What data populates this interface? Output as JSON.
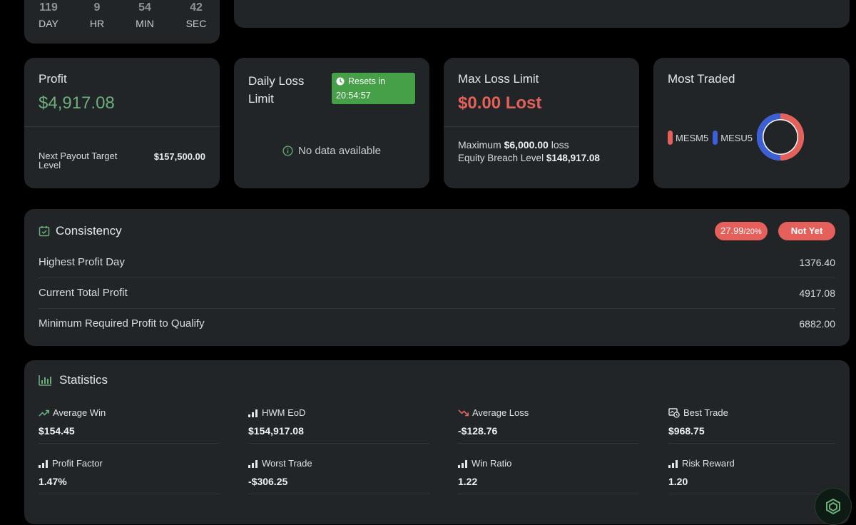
{
  "countdown": {
    "day": "119",
    "day_label": "DAY",
    "hr": "9",
    "hr_label": "HR",
    "min": "54",
    "min_label": "MIN",
    "sec": "42",
    "sec_label": "SEC"
  },
  "profit": {
    "title": "Profit",
    "value": "$4,917.08",
    "payout_label": "Next Payout Target Level",
    "payout_value": "$157,500.00"
  },
  "daily_loss": {
    "title": "Daily Loss Limit",
    "resets_label": "Resets in",
    "resets_time": "20:54:57",
    "empty_text": "No data available"
  },
  "max_loss": {
    "title": "Max Loss Limit",
    "value": "$0.00 Lost",
    "max_prefix": "Maximum",
    "max_amount": "$6,000.00",
    "max_suffix": "loss",
    "breach_label": "Equity Breach Level",
    "breach_value": "$148,917.08"
  },
  "most_traded": {
    "title": "Most Traded",
    "items": [
      {
        "label": "MESM5",
        "color": "#e5605a",
        "share": 0.5
      },
      {
        "label": "MESU5",
        "color": "#3b5fd6",
        "share": 0.5
      }
    ]
  },
  "consistency": {
    "title": "Consistency",
    "ratio": "27.99",
    "ratio_target": "/20%",
    "status": "Not Yet",
    "rows": [
      {
        "label": "Highest Profit Day",
        "value": "1376.40"
      },
      {
        "label": "Current Total Profit",
        "value": "4917.08"
      },
      {
        "label": "Minimum Required Profit to Qualify",
        "value": "6882.00"
      }
    ]
  },
  "statistics": {
    "title": "Statistics",
    "items": [
      {
        "label": "Average Win",
        "value": "$154.45",
        "icon": "trend-up-icon"
      },
      {
        "label": "HWM EoD",
        "value": "$154,917.08",
        "icon": "bar-chart-icon"
      },
      {
        "label": "Average Loss",
        "value": "-$128.76",
        "icon": "trend-down-icon"
      },
      {
        "label": "Best Trade",
        "value": "$968.75",
        "icon": "best-trade-icon"
      },
      {
        "label": "Profit Factor",
        "value": "1.47%",
        "icon": "bar-chart-icon"
      },
      {
        "label": "Worst Trade",
        "value": "-$306.25",
        "icon": "bar-chart-icon"
      },
      {
        "label": "Win Ratio",
        "value": "1.22",
        "icon": "bar-chart-icon"
      },
      {
        "label": "Risk Reward",
        "value": "1.20",
        "icon": "bar-chart-icon"
      }
    ]
  },
  "colors": {
    "background": "#000000",
    "card": "#212527",
    "positive": "#6cae7a",
    "negative": "#e5605a",
    "badge_green": "#45a047",
    "series_blue": "#3b5fd6"
  }
}
